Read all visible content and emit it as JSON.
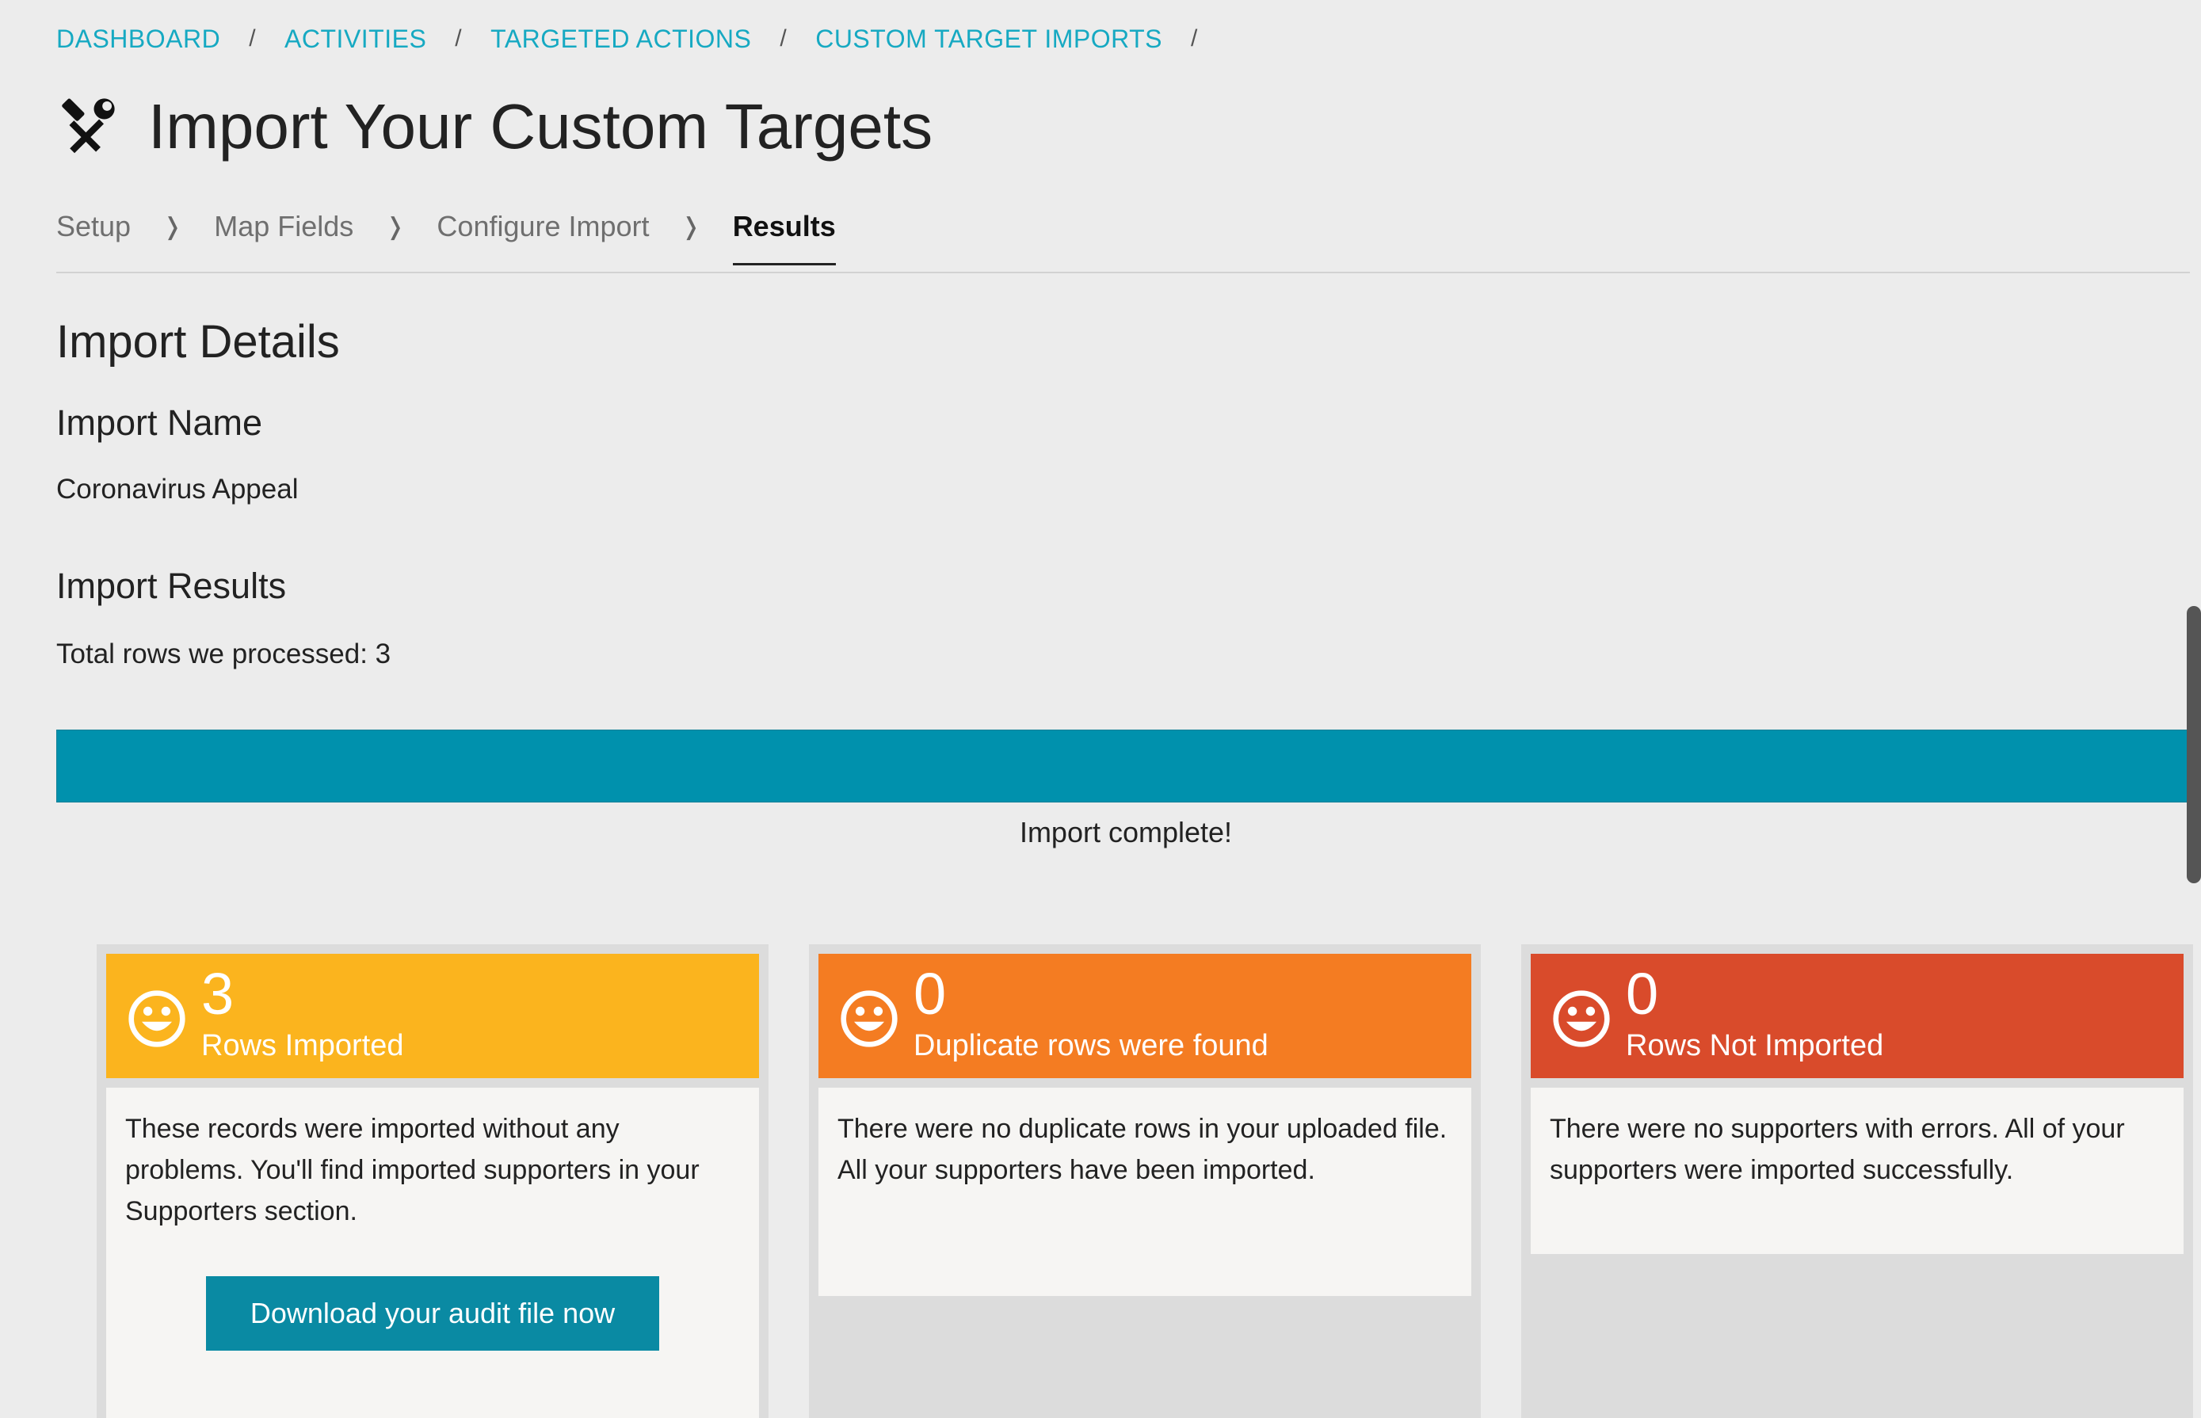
{
  "breadcrumb": {
    "items": [
      "DASHBOARD",
      "ACTIVITIES",
      "TARGETED ACTIONS",
      "CUSTOM TARGET IMPORTS"
    ],
    "separator": "/"
  },
  "header": {
    "icon": "tools-icon",
    "title": "Import Your Custom Targets"
  },
  "steps": {
    "items": [
      "Setup",
      "Map Fields",
      "Configure Import",
      "Results"
    ],
    "active_index": 3,
    "separator_icon": "chevron-right-icon"
  },
  "details": {
    "section_title": "Import Details",
    "name_heading": "Import Name",
    "name_value": "Coronavirus Appeal",
    "results_heading": "Import Results",
    "total_rows_text": "Total rows we processed: 3"
  },
  "progress": {
    "value_percent": 100,
    "label": "Import complete!",
    "color": "#0091ad"
  },
  "cards": [
    {
      "count": "3",
      "label": "Rows Imported",
      "icon": "smiley-icon",
      "color": "#fbb41e",
      "text": "These records were imported without any problems. You'll find imported supporters in your Supporters section.",
      "button_label": "Download your audit file now"
    },
    {
      "count": "0",
      "label": "Duplicate rows were found",
      "icon": "smiley-icon",
      "color": "#f47c22",
      "text": "There were no duplicate rows in your uploaded file. All your supporters have been imported."
    },
    {
      "count": "0",
      "label": "Rows Not Imported",
      "icon": "smiley-icon",
      "color": "#d94b2b",
      "text": "There were no supporters with errors. All of your supporters were imported successfully."
    }
  ]
}
